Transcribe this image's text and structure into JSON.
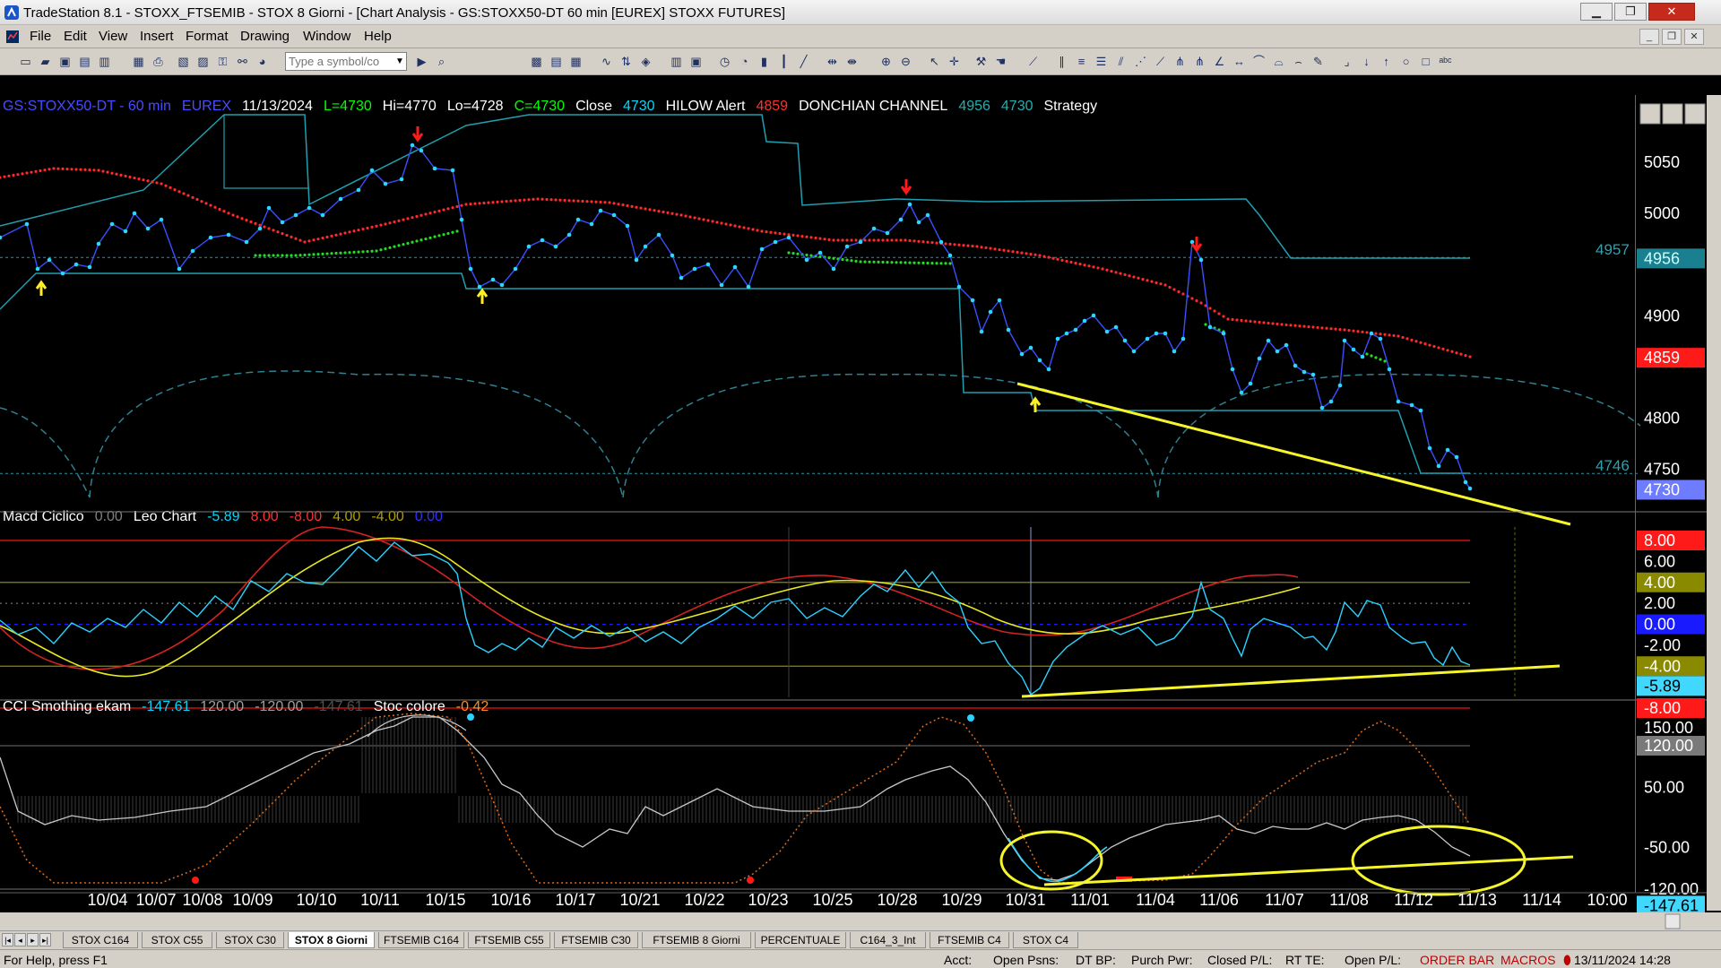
{
  "window": {
    "title": "TradeStation 8.1 - STOXX_FTSEMIB - STOX  8 Giorni - [Chart Analysis - GS:STOXX50-DT  60 min  [EUREX] STOXX FUTURES]"
  },
  "menu": [
    "File",
    "Edit",
    "View",
    "Insert",
    "Format",
    "Drawing",
    "Window",
    "Help"
  ],
  "toolbar": {
    "symbol_placeholder": "Type a symbol/co"
  },
  "price_pane": {
    "header": [
      {
        "text": "GS:STOXX50-DT - 60 min",
        "color": "#4a4aff"
      },
      {
        "text": "EUREX",
        "color": "#4a4aff"
      },
      {
        "text": "11/13/2024",
        "color": "#ffffff"
      },
      {
        "text": "L=4730",
        "color": "#00ff00"
      },
      {
        "text": "Hi=4770",
        "color": "#ffffff"
      },
      {
        "text": "Lo=4728",
        "color": "#ffffff"
      },
      {
        "text": "C=4730",
        "color": "#00ff00"
      },
      {
        "text": "Close",
        "color": "#ffffff"
      },
      {
        "text": "4730",
        "color": "#00d8ff"
      },
      {
        "text": "HILOW Alert",
        "color": "#ffffff"
      },
      {
        "text": "4859",
        "color": "#ff3030"
      },
      {
        "text": "DONCHIAN CHANNEL",
        "color": "#ffffff"
      },
      {
        "text": "4956",
        "color": "#20b0b0"
      },
      {
        "text": "4730",
        "color": "#20b0b0"
      },
      {
        "text": "Strategy",
        "color": "#ffffff"
      }
    ],
    "axis": [
      {
        "label": "5050",
        "value": 5050
      },
      {
        "label": "5000",
        "value": 5000
      },
      {
        "label": "4900",
        "value": 4900
      },
      {
        "label": "4800",
        "value": 4800
      },
      {
        "label": "4750",
        "value": 4750
      }
    ],
    "markers": [
      {
        "label": "4956",
        "value": 4956,
        "bg": "#1a7f8f",
        "fg": "#c8ffff"
      },
      {
        "label": "4859",
        "value": 4859,
        "bg": "#ff1a1a",
        "fg": "#ffffff"
      },
      {
        "label": "4730",
        "value": 4730,
        "bg": "#6e7cff",
        "fg": "#ffffff"
      }
    ],
    "left_labels": [
      {
        "label": "4957",
        "value": 4957
      },
      {
        "label": "4746",
        "value": 4746
      }
    ]
  },
  "macd_pane": {
    "header": [
      {
        "text": "Macd Ciclico",
        "color": "#ffffff"
      },
      {
        "text": "0.00",
        "color": "#808080"
      },
      {
        "text": "Leo Chart",
        "color": "#ffffff"
      },
      {
        "text": "-5.89",
        "color": "#00d8ff"
      },
      {
        "text": "8.00",
        "color": "#ff3030"
      },
      {
        "text": "-8.00",
        "color": "#ff3030"
      },
      {
        "text": "4.00",
        "color": "#b0a000"
      },
      {
        "text": "-4.00",
        "color": "#b0a000"
      },
      {
        "text": "0.00",
        "color": "#3030ff"
      }
    ],
    "axis": [
      {
        "label": "8.00",
        "value": 8,
        "bg": "#ff1a1a",
        "fg": "#ffffff"
      },
      {
        "label": "6.00",
        "value": 6,
        "bg": "",
        "fg": "#ffffff"
      },
      {
        "label": "4.00",
        "value": 4,
        "bg": "#8a8a00",
        "fg": "#ffffff"
      },
      {
        "label": "2.00",
        "value": 2,
        "bg": "",
        "fg": "#ffffff"
      },
      {
        "label": "0.00",
        "value": 0,
        "bg": "#1a1aff",
        "fg": "#ffffff"
      },
      {
        "label": "-2.00",
        "value": -2,
        "bg": "",
        "fg": "#ffffff"
      },
      {
        "label": "-4.00",
        "value": -4,
        "bg": "#8a8a00",
        "fg": "#ffffff"
      },
      {
        "label": "-5.89",
        "value": -5.89,
        "bg": "#40d8ff",
        "fg": "#000000"
      },
      {
        "label": "-8.00",
        "value": -8,
        "bg": "#ff1a1a",
        "fg": "#ffffff"
      }
    ]
  },
  "cci_pane": {
    "header": [
      {
        "text": "CCI Smothing ekam",
        "color": "#ffffff"
      },
      {
        "text": "-147.61",
        "color": "#00d8ff"
      },
      {
        "text": "120.00",
        "color": "#a0a0a0"
      },
      {
        "text": "-120.00",
        "color": "#a0a0a0"
      },
      {
        "text": "-147.61",
        "color": "#505050"
      },
      {
        "text": "Stoc colore",
        "color": "#ffffff"
      },
      {
        "text": "-0.42",
        "color": "#ff8c20"
      }
    ],
    "axis": [
      {
        "label": "150.00",
        "value": 150,
        "bg": "",
        "fg": "#ffffff"
      },
      {
        "label": "120.00",
        "value": 120,
        "bg": "#7a7a7a",
        "fg": "#ffffff"
      },
      {
        "label": "50.00",
        "value": 50,
        "bg": "",
        "fg": "#ffffff"
      },
      {
        "label": "-50.00",
        "value": -50,
        "bg": "",
        "fg": "#ffffff"
      },
      {
        "label": "-120.00",
        "value": -120,
        "bg": "",
        "fg": "#ffffff"
      },
      {
        "label": "-147.61",
        "value": -147.61,
        "bg": "#40d8ff",
        "fg": "#000000"
      }
    ]
  },
  "time_axis": [
    "10/04",
    "10/07",
    "10/08",
    "10/09",
    "10/10",
    "10/11",
    "10/15",
    "10/16",
    "10/17",
    "10/21",
    "10/22",
    "10/23",
    "10/25",
    "10/28",
    "10/29",
    "10/31",
    "11/01",
    "11/04",
    "11/06",
    "11/07",
    "11/08",
    "11/12",
    "11/13",
    "11/14",
    "10:00"
  ],
  "tabs": [
    "STOX C164",
    "STOX C55",
    "STOX  C30",
    "STOX  8 Giorni",
    "FTSEMIB C164",
    "FTSEMIB C55",
    "FTSEMIB C30",
    "FTSEMIB  8 Giorni",
    "PERCENTUALE",
    "C164_3_Int",
    "FTSEMIB C4",
    "STOX  C4"
  ],
  "active_tab": "STOX  8 Giorni",
  "status": {
    "help": "For Help, press F1",
    "acct": "Acct:",
    "open_psns": "Open Psns:",
    "dt_bp": "DT BP:",
    "purch_pwr": "Purch Pwr:",
    "closed_pl": "Closed P/L:",
    "rt_te": "RT TE:",
    "open_pl": "Open P/L:",
    "order_bar": "ORDER BAR",
    "macros": "MACROS",
    "datetime": "13/11/2024 14:28"
  }
}
